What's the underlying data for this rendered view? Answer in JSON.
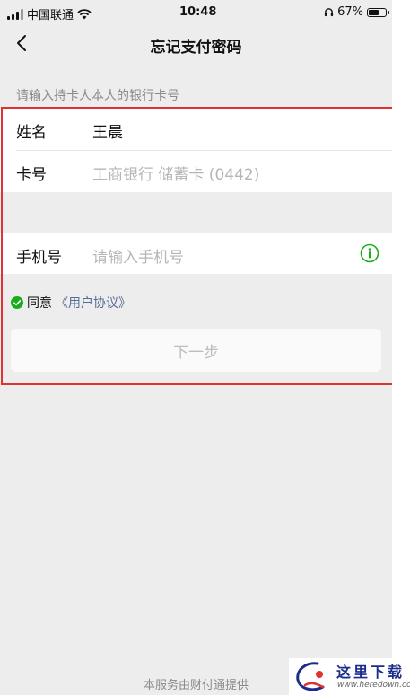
{
  "status_bar": {
    "carrier": "中国联通",
    "time": "10:48",
    "battery": "67%",
    "battery_level": 0.67
  },
  "nav": {
    "title": "忘记支付密码",
    "back_icon": "chevron-left-icon"
  },
  "form": {
    "hint": "请输入持卡人本人的银行卡号",
    "name_label": "姓名",
    "name_value": "王晨",
    "card_label": "卡号",
    "card_value": "工商银行 储蓄卡 (0442)",
    "phone_label": "手机号",
    "phone_placeholder": "请输入手机号",
    "info_icon": "info-icon"
  },
  "agreement": {
    "prefix": "同意",
    "link": "《用户协议》",
    "checked": true
  },
  "next_button": "下一步",
  "footer": "本服务由财付通提供",
  "watermark": {
    "cn": "这里下载",
    "url": "www.heredown.com"
  },
  "colors": {
    "accent_green": "#1aad19",
    "link_blue": "#576b95",
    "highlight_red": "#e0322e"
  }
}
